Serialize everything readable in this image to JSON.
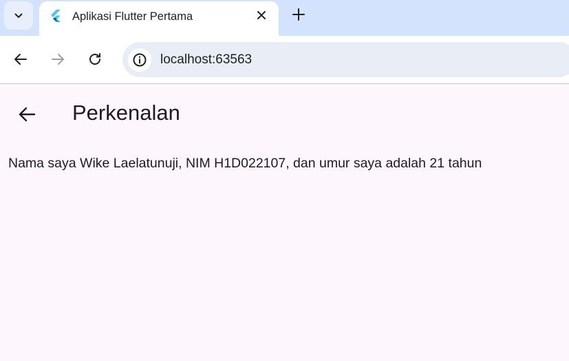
{
  "browser": {
    "tab": {
      "title": "Aplikasi Flutter Pertama",
      "favicon": "flutter-logo-icon"
    },
    "address_bar": {
      "url": "localhost:63563",
      "site_info_icon": "info-icon"
    },
    "buttons": {
      "tab_search": "chevron-down-icon",
      "close_tab": "close-icon",
      "new_tab": "plus-icon",
      "back": "arrow-left-icon",
      "forward": "arrow-right-icon",
      "reload": "reload-icon"
    },
    "colors": {
      "tabbar_bg": "#d3e3fd",
      "omnibox_bg": "#e9eef6",
      "forward_disabled": "#a0a0a0"
    }
  },
  "app": {
    "app_bar": {
      "title": "Perkenalan",
      "back_icon": "arrow-left-icon"
    },
    "body": {
      "text": "Nama saya Wike Laelatunuji, NIM H1D022107, dan umur saya adalah 21 tahun"
    },
    "colors": {
      "background": "#fdf6fd",
      "text": "#1d1b20"
    }
  }
}
